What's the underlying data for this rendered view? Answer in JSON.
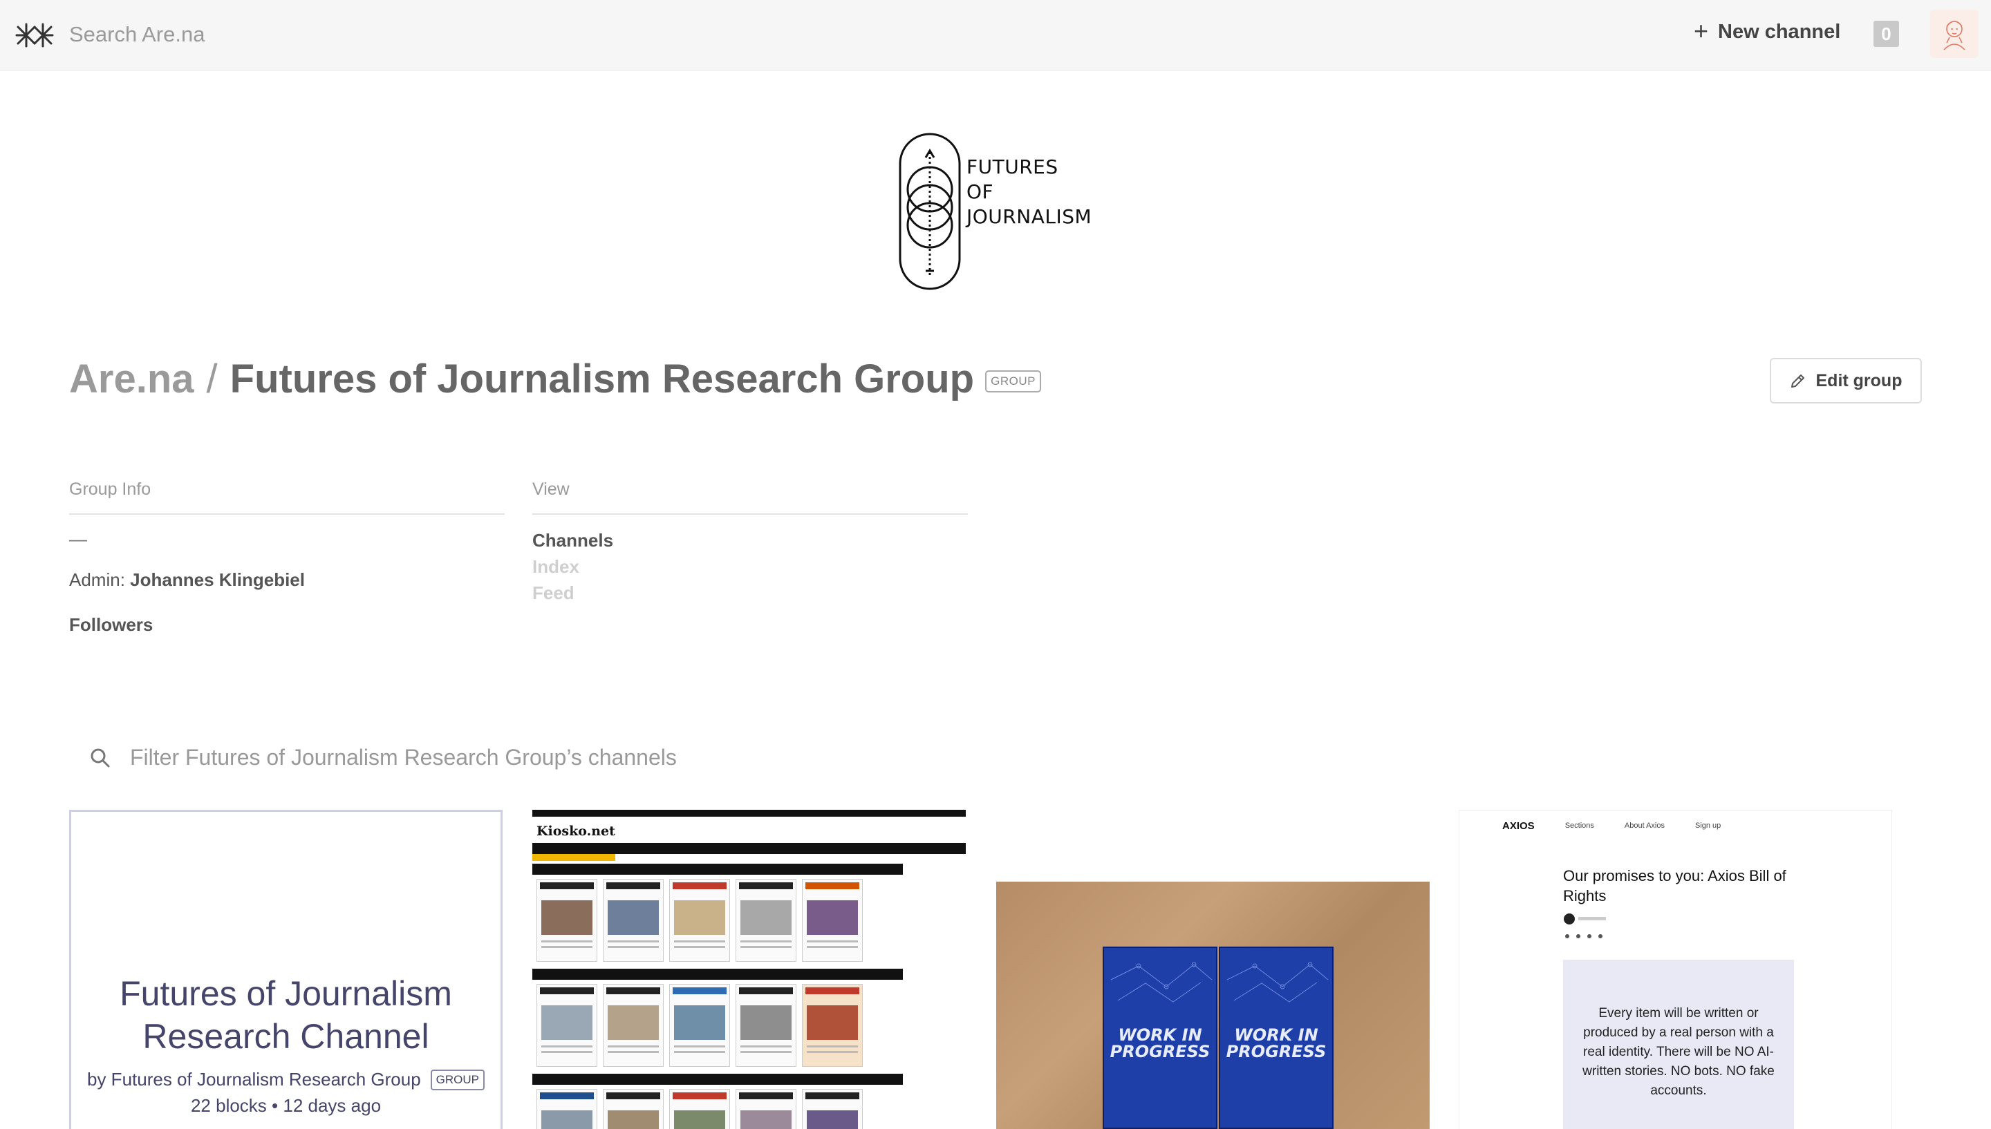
{
  "topbar": {
    "logo_icon": "arena-asterisks-icon",
    "search_placeholder": "Search Are.na",
    "new_channel_label": "New channel",
    "notification_count": "0"
  },
  "group_logo": {
    "line1": "FUTURES",
    "line2": "OF",
    "line3": "JOURNALISM"
  },
  "header": {
    "breadcrumb_root": "Are.na",
    "separator": "/",
    "title": "Futures of Journalism Research Group",
    "badge": "GROUP",
    "edit_label": "Edit group"
  },
  "info": {
    "group_info_heading": "Group Info",
    "description": "—",
    "admin_label": "Admin:",
    "admin_name": "Johannes Klingebiel",
    "followers_label": "Followers",
    "view_heading": "View",
    "views": [
      "Channels",
      "Index",
      "Feed"
    ],
    "active_view": "Channels"
  },
  "filter": {
    "placeholder": "Filter Futures of Journalism Research Group’s channels"
  },
  "cards": [
    {
      "type": "channel",
      "title_line1": "Futures of Journalism",
      "title_line2": "Research Channel",
      "by": "by Futures of Journalism Research Group",
      "badge": "GROUP",
      "meta": "22 blocks • 12 days ago"
    },
    {
      "type": "image",
      "site_name": "Kiosko.net"
    },
    {
      "type": "image",
      "book_text_line1": "WORK IN",
      "book_text_line2": "PROGRESS"
    },
    {
      "type": "image",
      "nav_logo": "AXIOS",
      "nav_items": [
        "Sections",
        "About Axios",
        "Sign up"
      ],
      "headline": "Our promises to you: Axios Bill of Rights",
      "quote": "Every item will be written or produced by a real person with a real identity. There will be NO AI-written stories. NO bots. NO fake accounts."
    }
  ],
  "colors": {
    "topbar_bg": "#f6f6f6",
    "channel_text": "#45446a",
    "title_gray": "#666666"
  }
}
